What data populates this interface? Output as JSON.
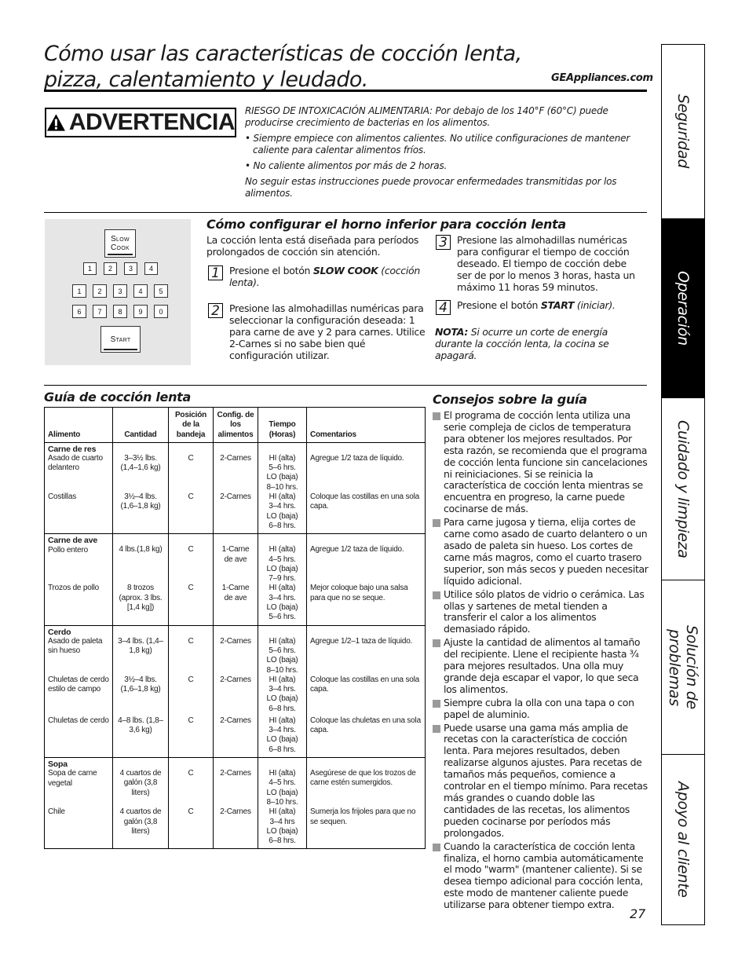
{
  "header": {
    "title_line1": "Cómo usar las características de cocción lenta,",
    "title_line2": "pizza, calentamiento y leudado.",
    "website": "GEAppliances.com"
  },
  "warning": {
    "icon": "warning-triangle-icon",
    "label": "ADVERTENCIA",
    "risk": "RIESGO DE INTOXICACIÓN ALIMENTARIA: Por debajo de los 140°F (60°C) puede producirse crecimiento de bacterias en los alimentos.",
    "bullets": [
      "• Siempre empiece con alimentos calientes. No utilice configuraciones de mantener caliente para calentar alimentos fríos.",
      "• No caliente alimentos por más de 2 horas."
    ],
    "footer": "No seguir estas instrucciones puede provocar enfermedades transmitidas por los alimentos."
  },
  "keypad": {
    "slow_cook_line1": "Slow",
    "slow_cook_line2": "Cook",
    "setting_keys": [
      "1",
      "2",
      "3",
      "4"
    ],
    "number_row1": [
      "1",
      "2",
      "3",
      "4",
      "5"
    ],
    "number_row2": [
      "6",
      "7",
      "8",
      "9",
      "0"
    ],
    "start": "Start"
  },
  "setup": {
    "title": "Cómo configurar el horno inferior para cocción lenta",
    "intro": "La cocción lenta está diseñada para períodos prolongados de cocción sin atención.",
    "steps": [
      {
        "num": "1",
        "pre": "Presione el botón ",
        "bold": "SLOW COOK",
        "post": " (cocción lenta)."
      },
      {
        "num": "2",
        "text": "Presione las almohadillas numéricas para seleccionar la configuración deseada: 1 para carne de ave y 2 para carnes. Utilice 2-Carnes si no sabe bien qué configuración utilizar."
      },
      {
        "num": "3",
        "text": "Presione las almohadillas numéricas para configurar el tiempo de cocción deseado. El tiempo de cocción debe ser de por lo menos 3 horas, hasta un máximo 11 horas 59 minutos."
      },
      {
        "num": "4",
        "pre": "Presione el botón ",
        "bold": "START",
        "post": " (iniciar)."
      }
    ],
    "note_label": "NOTA:",
    "note_text": " Si ocurre un corte de energía durante la cocción lenta, la cocina se apagará."
  },
  "guide": {
    "title": "Guía de cocción lenta",
    "headers": [
      "Alimento",
      "Cantidad",
      "Posición de la bandeja",
      "Config. de los alimentos",
      "Tiempo (Horas)",
      "Comentarios"
    ],
    "groups": [
      {
        "name": "Carne de res",
        "rows": [
          {
            "food": "Asado de cuarto delantero",
            "qty": "3–3½ lbs. (1,4–1,6 kg)",
            "pos": "C",
            "cfg": "2-Carnes",
            "time": "HI (alta) 5–6 hrs. LO (baja) 8–10 hrs.",
            "comment": "Agregue 1/2 taza de líquido."
          },
          {
            "food": "Costillas",
            "qty": "3½–4 lbs. (1,6–1,8 kg)",
            "pos": "C",
            "cfg": "2-Carnes",
            "time": "HI (alta) 3–4 hrs. LO (baja) 6–8 hrs.",
            "comment": "Coloque las costillas en una sola capa."
          }
        ]
      },
      {
        "name": "Carne de ave",
        "rows": [
          {
            "food": "Pollo entero",
            "qty": "4 lbs.(1,8 kg)",
            "pos": "C",
            "cfg": "1-Carne de ave",
            "time": "HI (alta) 4–5 hrs. LO (baja) 7–9 hrs.",
            "comment": "Agregue 1/2 taza de líquido."
          },
          {
            "food": "Trozos de pollo",
            "qty": "8 trozos (aprox. 3 lbs. [1,4 kg])",
            "pos": "C",
            "cfg": "1-Carne de ave",
            "time": "HI (alta) 3–4 hrs. LO (baja) 5–6 hrs.",
            "comment": "Mejor coloque bajo una salsa para que no se seque."
          }
        ]
      },
      {
        "name": "Cerdo",
        "rows": [
          {
            "food": "Asado de paleta sin hueso",
            "qty": "3–4 lbs. (1,4–1,8 kg)",
            "pos": "C",
            "cfg": "2-Carnes",
            "time": "HI (alta) 5–6 hrs. LO (baja) 8–10 hrs.",
            "comment": "Agregue 1/2–1 taza de líquido."
          },
          {
            "food": "Chuletas de cerdo estilo de campo",
            "qty": "3½–4 lbs. (1,6–1,8 kg)",
            "pos": "C",
            "cfg": "2-Carnes",
            "time": "HI (alta) 3–4 hrs. LO (baja) 6–8 hrs.",
            "comment": "Coloque las costillas en una sola capa."
          },
          {
            "food": "Chuletas de cerdo",
            "qty": "4–8 lbs. (1,8–3,6 kg)",
            "pos": "C",
            "cfg": "2-Carnes",
            "time": "HI (alta) 3–4 hrs. LO (baja) 6–8 hrs.",
            "comment": "Coloque las chuletas en una sola capa."
          }
        ]
      },
      {
        "name": "Sopa",
        "rows": [
          {
            "food": "Sopa de carne vegetal",
            "qty": "4 cuartos de galón (3,8 liters)",
            "pos": "C",
            "cfg": "2-Carnes",
            "time": "HI (alta) 4–5 hrs. LO (baja) 8–10 hrs.",
            "comment": "Asegúrese de que los trozos de carne estén sumergidos."
          },
          {
            "food": "Chile",
            "qty": "4 cuartos de galón (3,8 liters)",
            "pos": "C",
            "cfg": "2-Carnes",
            "time": "HI (alta) 3–4 hrs LO (baja) 6–8 hrs.",
            "comment": "Sumerja los frijoles para que no se sequen."
          }
        ]
      }
    ]
  },
  "tips": {
    "title": "Consejos sobre la guía",
    "items": [
      "El programa de cocción lenta utiliza una serie compleja de ciclos de temperatura para obtener los mejores resultados. Por esta razón, se recomienda que el programa de cocción lenta funcione sin cancelaciones ni reiniciaciones. Si se reinicia la característica de cocción lenta mientras se encuentra en progreso, la carne puede cocinarse de más.",
      "Para carne jugosa y tierna, elija cortes de carne como asado de cuarto delantero o un asado de paleta sin hueso. Los cortes de carne más magros, como el cuarto trasero superior, son más secos y pueden necesitar líquido adicional.",
      "Utilice sólo platos de vidrio o cerámica. Las ollas y sartenes de metal tienden a transferir el calor a los alimentos demasiado rápido.",
      "Ajuste la cantidad de alimentos al tamaño del recipiente. Llene el recipiente hasta ¾ para mejores resultados. Una olla muy grande deja escapar el vapor, lo que seca los alimentos.",
      "Siempre cubra la olla con una tapa o con papel de aluminio.",
      "Puede usarse una gama más amplia de recetas con la característica de cocción lenta. Para mejores resultados, deben realizarse algunos ajustes. Para recetas de tamaños más pequeños, comience a controlar en el tiempo mínimo. Para recetas más grandes o cuando doble las cantidades de las recetas, los alimentos pueden cocinarse por períodos más prolongados.",
      "Cuando la característica de cocción lenta finaliza, el horno cambia automáticamente el modo \"warm\" (mantener caliente). Si se desea tiempo adicional para cocción lenta, este modo de mantener caliente puede utilizarse para obtener tiempo extra."
    ]
  },
  "page_number": "27",
  "sidetabs": [
    {
      "label": "Seguridad",
      "active": false
    },
    {
      "label": "Operación",
      "active": true
    },
    {
      "label": "Cuidado y limpieza",
      "active": false
    },
    {
      "label": "Solución de\nproblemas",
      "active": false
    },
    {
      "label": "Apoyo al cliente",
      "active": false
    }
  ],
  "colors": {
    "keypad_bg": "#e6e6e6",
    "tip_bullet": "#9a9a9a",
    "active_tab_bg": "#000000"
  }
}
